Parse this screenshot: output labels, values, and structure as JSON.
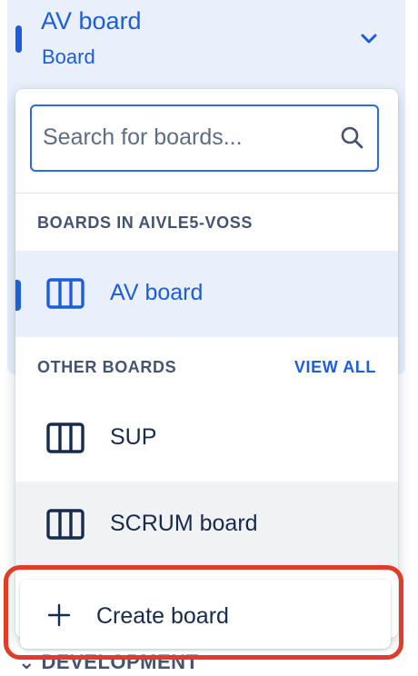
{
  "current_board": {
    "title": "AV board",
    "subtitle": "Board",
    "chevron_icon": "chevron-down-icon"
  },
  "background_sections": {
    "development_label": "DEVELOPMENT"
  },
  "dropdown": {
    "search": {
      "placeholder": "Search for boards...",
      "value": "",
      "icon": "search-icon"
    },
    "project_section": {
      "header": "BOARDS IN AIVLE5-VOSS",
      "items": [
        {
          "label": "AV board",
          "icon": "board-columns-icon",
          "selected": true
        }
      ]
    },
    "other_section": {
      "header": "OTHER BOARDS",
      "view_all": "VIEW ALL",
      "items": [
        {
          "label": "SUP",
          "icon": "board-columns-icon"
        },
        {
          "label": "SCRUM board",
          "icon": "board-columns-icon",
          "hovered": true
        }
      ]
    },
    "create": {
      "label": "Create board",
      "icon": "plus-icon"
    }
  },
  "colors": {
    "accent": "#1d5dd8",
    "selected_bg": "#e9f0fc",
    "highlight_outline": "#e03c2a"
  }
}
